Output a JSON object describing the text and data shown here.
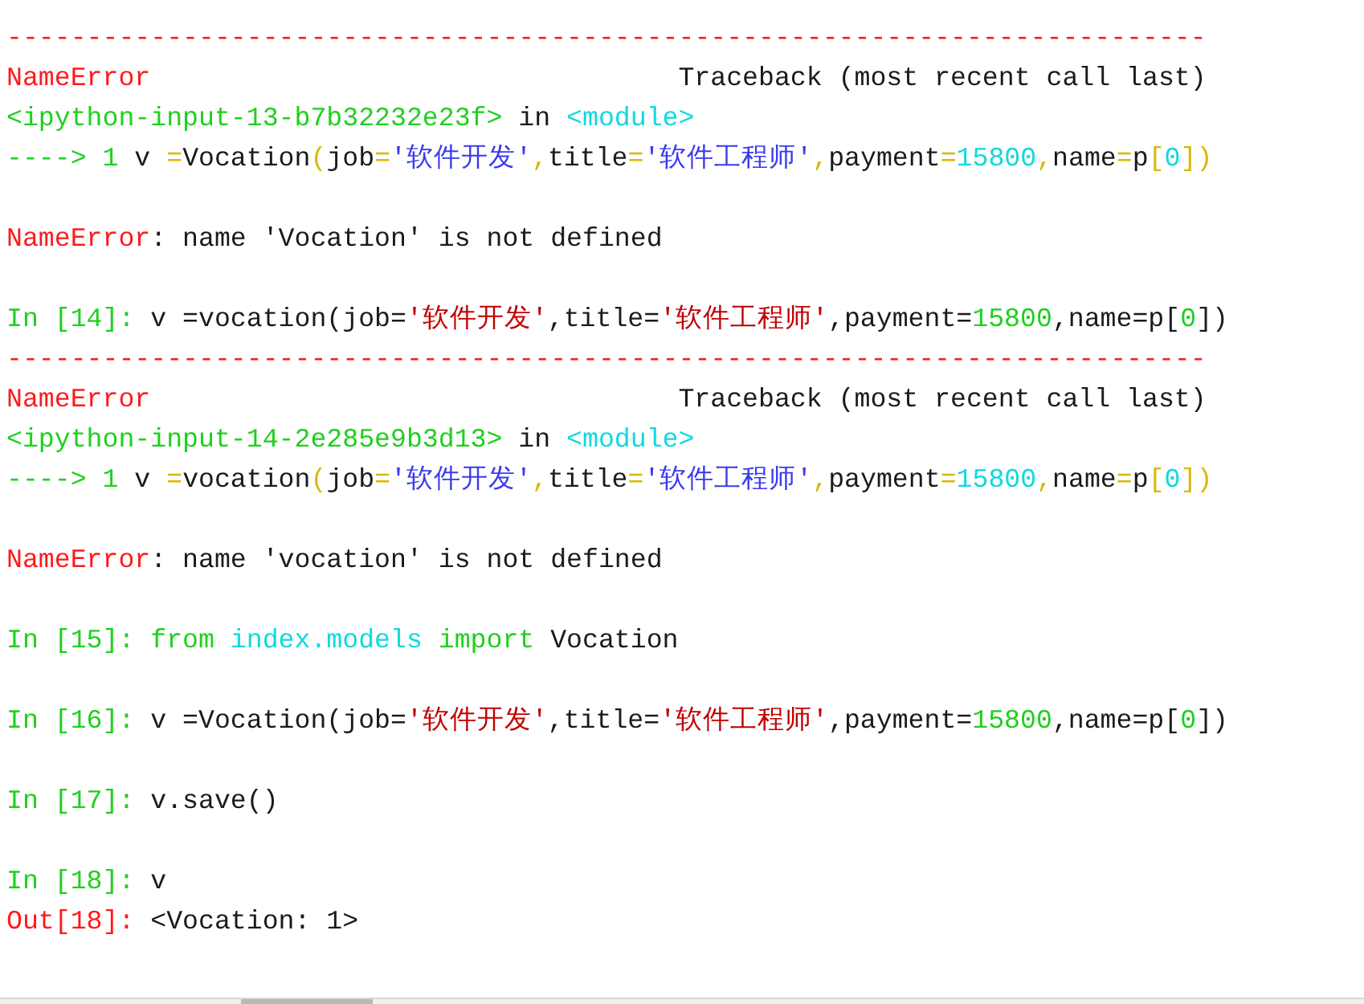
{
  "lines": [
    {
      "segments": [
        {
          "kind": "error",
          "text": "---------------------------------------------------------------------------"
        }
      ]
    },
    {
      "segments": [
        {
          "kind": "error",
          "text": "NameError"
        },
        {
          "kind": "plain",
          "text": "Traceback (most recent call last)",
          "push": true
        }
      ]
    },
    {
      "segments": [
        {
          "kind": "prompt",
          "text": "<ipython-input-13-b7b32232e23f>"
        },
        {
          "kind": "plain",
          "text": " in "
        },
        {
          "kind": "module",
          "text": "<module>"
        }
      ]
    },
    {
      "segments": [
        {
          "kind": "prompt",
          "text": "----> 1 "
        },
        {
          "kind": "plain",
          "text": "v "
        },
        {
          "kind": "punct",
          "text": "="
        },
        {
          "kind": "plain",
          "text": "Vocation"
        },
        {
          "kind": "punct",
          "text": "("
        },
        {
          "kind": "plain",
          "text": "job"
        },
        {
          "kind": "punct",
          "text": "="
        },
        {
          "kind": "tbstring",
          "text": "'软件开发'"
        },
        {
          "kind": "punct",
          "text": ","
        },
        {
          "kind": "plain",
          "text": "title"
        },
        {
          "kind": "punct",
          "text": "="
        },
        {
          "kind": "tbstring",
          "text": "'软件工程师'"
        },
        {
          "kind": "punct",
          "text": ","
        },
        {
          "kind": "plain",
          "text": "payment"
        },
        {
          "kind": "punct",
          "text": "="
        },
        {
          "kind": "tbnumber",
          "text": "15800"
        },
        {
          "kind": "punct",
          "text": ","
        },
        {
          "kind": "plain",
          "text": "name"
        },
        {
          "kind": "punct",
          "text": "="
        },
        {
          "kind": "plain",
          "text": "p"
        },
        {
          "kind": "punct",
          "text": "["
        },
        {
          "kind": "tbnumber",
          "text": "0"
        },
        {
          "kind": "punct",
          "text": "])"
        }
      ]
    },
    {
      "space_before": true,
      "segments": [
        {
          "kind": "error",
          "text": "NameError"
        },
        {
          "kind": "plain",
          "text": ": name 'Vocation' is not defined"
        }
      ]
    },
    {
      "space_before": true,
      "segments": [
        {
          "kind": "prompt",
          "text": "In [14]: "
        },
        {
          "kind": "plain",
          "text": "v =vocation(job="
        },
        {
          "kind": "string",
          "text": "'软件开发'"
        },
        {
          "kind": "plain",
          "text": ",title="
        },
        {
          "kind": "string",
          "text": "'软件工程师'"
        },
        {
          "kind": "plain",
          "text": ",payment="
        },
        {
          "kind": "number",
          "text": "15800"
        },
        {
          "kind": "plain",
          "text": ",name=p["
        },
        {
          "kind": "number",
          "text": "0"
        },
        {
          "kind": "plain",
          "text": "])"
        }
      ]
    },
    {
      "segments": [
        {
          "kind": "error",
          "text": "---------------------------------------------------------------------------"
        }
      ]
    },
    {
      "segments": [
        {
          "kind": "error",
          "text": "NameError"
        },
        {
          "kind": "plain",
          "text": "Traceback (most recent call last)",
          "push": true
        }
      ]
    },
    {
      "segments": [
        {
          "kind": "prompt",
          "text": "<ipython-input-14-2e285e9b3d13>"
        },
        {
          "kind": "plain",
          "text": " in "
        },
        {
          "kind": "module",
          "text": "<module>"
        }
      ]
    },
    {
      "segments": [
        {
          "kind": "prompt",
          "text": "----> 1 "
        },
        {
          "kind": "plain",
          "text": "v "
        },
        {
          "kind": "punct",
          "text": "="
        },
        {
          "kind": "plain",
          "text": "vocation"
        },
        {
          "kind": "punct",
          "text": "("
        },
        {
          "kind": "plain",
          "text": "job"
        },
        {
          "kind": "punct",
          "text": "="
        },
        {
          "kind": "tbstring",
          "text": "'软件开发'"
        },
        {
          "kind": "punct",
          "text": ","
        },
        {
          "kind": "plain",
          "text": "title"
        },
        {
          "kind": "punct",
          "text": "="
        },
        {
          "kind": "tbstring",
          "text": "'软件工程师'"
        },
        {
          "kind": "punct",
          "text": ","
        },
        {
          "kind": "plain",
          "text": "payment"
        },
        {
          "kind": "punct",
          "text": "="
        },
        {
          "kind": "tbnumber",
          "text": "15800"
        },
        {
          "kind": "punct",
          "text": ","
        },
        {
          "kind": "plain",
          "text": "name"
        },
        {
          "kind": "punct",
          "text": "="
        },
        {
          "kind": "plain",
          "text": "p"
        },
        {
          "kind": "punct",
          "text": "["
        },
        {
          "kind": "tbnumber",
          "text": "0"
        },
        {
          "kind": "punct",
          "text": "])"
        }
      ]
    },
    {
      "space_before": true,
      "segments": [
        {
          "kind": "error",
          "text": "NameError"
        },
        {
          "kind": "plain",
          "text": ": name 'vocation' is not defined"
        }
      ]
    },
    {
      "space_before": true,
      "segments": [
        {
          "kind": "prompt",
          "text": "In [15]: "
        },
        {
          "kind": "keyword",
          "text": "from "
        },
        {
          "kind": "module",
          "text": "index.models "
        },
        {
          "kind": "keyword",
          "text": "import "
        },
        {
          "kind": "plain",
          "text": "Vocation"
        }
      ]
    },
    {
      "space_before": true,
      "segments": [
        {
          "kind": "prompt",
          "text": "In [16]: "
        },
        {
          "kind": "plain",
          "text": "v =Vocation(job="
        },
        {
          "kind": "string",
          "text": "'软件开发'"
        },
        {
          "kind": "plain",
          "text": ",title="
        },
        {
          "kind": "string",
          "text": "'软件工程师'"
        },
        {
          "kind": "plain",
          "text": ",payment="
        },
        {
          "kind": "number",
          "text": "15800"
        },
        {
          "kind": "plain",
          "text": ",name=p["
        },
        {
          "kind": "number",
          "text": "0"
        },
        {
          "kind": "plain",
          "text": "])"
        }
      ]
    },
    {
      "space_before": true,
      "segments": [
        {
          "kind": "prompt",
          "text": "In [17]: "
        },
        {
          "kind": "plain",
          "text": "v.save()"
        }
      ]
    },
    {
      "space_before": true,
      "segments": [
        {
          "kind": "prompt",
          "text": "In [18]: "
        },
        {
          "kind": "plain",
          "text": "v"
        }
      ]
    },
    {
      "segments": [
        {
          "kind": "error",
          "text": "Out[18]: "
        },
        {
          "kind": "plain",
          "text": "<Vocation: 1>"
        }
      ]
    }
  ]
}
